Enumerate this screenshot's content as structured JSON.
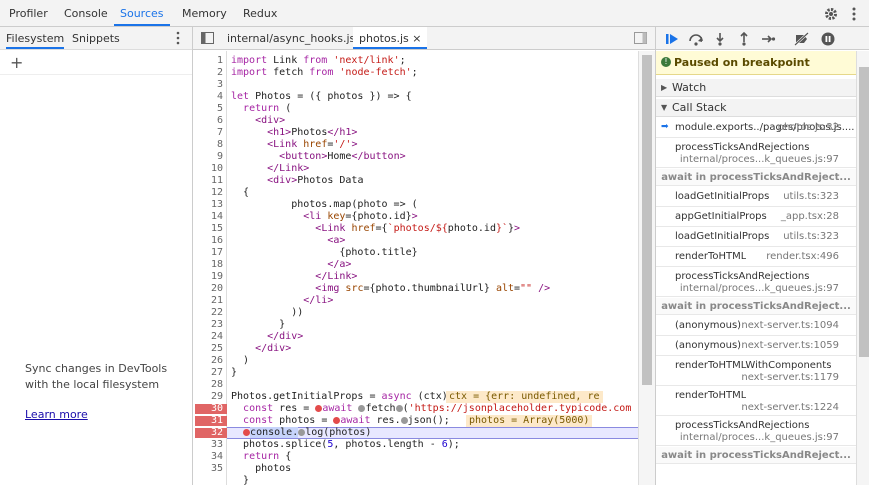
{
  "top_tabs": [
    "Profiler",
    "Console",
    "Sources",
    "Memory",
    "Redux"
  ],
  "left": {
    "tabs": [
      "Filesystem",
      "Snippets"
    ],
    "sync_text": "Sync changes in DevTools with the local filesystem",
    "learn_more": "Learn more"
  },
  "editor": {
    "tabs": [
      "internal/async_hooks.js",
      "photos.js"
    ],
    "close_glyph": "×",
    "line_numbers": [
      "1",
      "2",
      "3",
      "4",
      "5",
      "6",
      "7",
      "8",
      "9",
      "10",
      "11",
      "12",
      "13",
      "14",
      "15",
      "16",
      "17",
      "18",
      "19",
      "20",
      "21",
      "22",
      "23",
      "24",
      "25",
      "26",
      "27",
      "28",
      "29",
      "30",
      "31",
      "32",
      "33",
      "34",
      "35"
    ],
    "breakpoint_lines": [
      30,
      31,
      32
    ],
    "current_line": 32
  },
  "debugger": {
    "paused": "Paused on breakpoint",
    "watch": "Watch",
    "call_stack": "Call Stack",
    "frames": [
      {
        "fn": "module.exports../pages/photos.js....",
        "loc": "photos.js:32",
        "current": true
      },
      {
        "fn": "processTicksAndRejections",
        "loc": "internal/proces...k_queues.js:97"
      },
      {
        "async": "await in processTicksAndReject..."
      },
      {
        "fn": "loadGetInitialProps",
        "loc": "utils.ts:323"
      },
      {
        "fn": "appGetInitialProps",
        "loc": "_app.tsx:28"
      },
      {
        "fn": "loadGetInitialProps",
        "loc": "utils.ts:323"
      },
      {
        "fn": "renderToHTML",
        "loc": "render.tsx:496"
      },
      {
        "fn": "processTicksAndRejections",
        "loc": "internal/proces...k_queues.js:97"
      },
      {
        "async": "await in processTicksAndReject..."
      },
      {
        "fn": "(anonymous)",
        "loc": "next-server.ts:1094"
      },
      {
        "fn": "(anonymous)",
        "loc": "next-server.ts:1059"
      },
      {
        "fn": "renderToHTMLWithComponents",
        "loc": "next-server.ts:1179"
      },
      {
        "fn": "renderToHTML",
        "loc": "next-server.ts:1224"
      },
      {
        "fn": "processTicksAndRejections",
        "loc": "internal/proces...k_queues.js:97"
      },
      {
        "async": "await in processTicksAndReject..."
      }
    ]
  }
}
